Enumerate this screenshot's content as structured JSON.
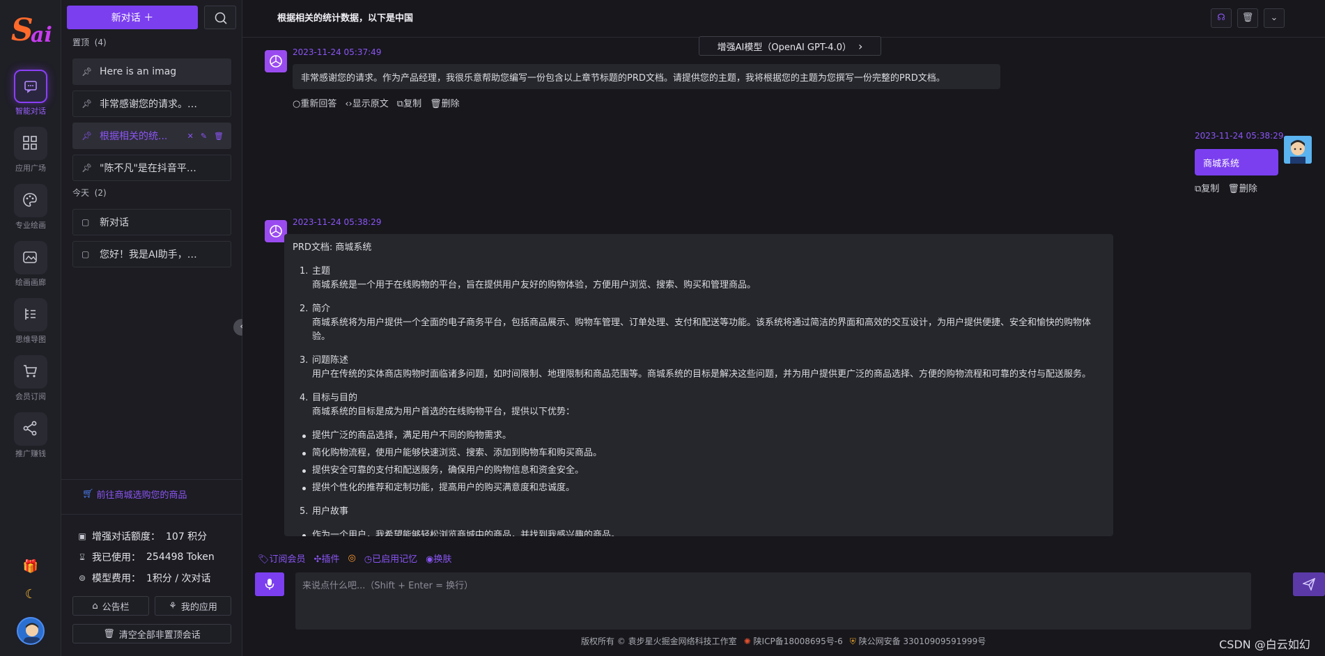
{
  "rail": {
    "items": [
      {
        "label": "智能对话",
        "icon": "chat-icon",
        "active": true
      },
      {
        "label": "应用广场",
        "icon": "grid-icon"
      },
      {
        "label": "专业绘画",
        "icon": "palette-icon"
      },
      {
        "label": "绘画画廊",
        "icon": "gallery-icon"
      },
      {
        "label": "思维导图",
        "icon": "mindmap-icon"
      },
      {
        "label": "会员订阅",
        "icon": "cart-icon"
      },
      {
        "label": "推广赚钱",
        "icon": "share-icon"
      }
    ]
  },
  "sidebar": {
    "new_chat": "新对话 ＋",
    "pinned_label": "置顶",
    "pinned_count": "(4)",
    "today_label": "今天",
    "today_count": "(2)",
    "pinned": [
      "Here is an imag",
      "非常感谢您的请求。作为...",
      "根据相关的统...",
      "\"陈不凡\"是在抖音平台上..."
    ],
    "today": [
      "新对话",
      "您好！我是AI助手，我可..."
    ],
    "shop_link": "前往商城选购您的商品",
    "stats": [
      {
        "label": "增强对话额度：",
        "value": "107 积分"
      },
      {
        "label": "我已使用：",
        "value": "254498 Token"
      },
      {
        "label": "模型费用：",
        "value": "1积分 / 次对话"
      }
    ],
    "notice_btn": "公告栏",
    "my_apps_btn": "我的应用",
    "clear_btn": "清空全部非置顶会话"
  },
  "main": {
    "title": "根据相关的统计数据，以下是中国",
    "model": "增强AI模型（OpenAI GPT-4.0）",
    "msg1": {
      "time": "2023-11-24 05:37:49",
      "text": "非常感谢您的请求。作为产品经理，我很乐意帮助您编写一份包含以上章节标题的PRD文档。请提供您的主题，我将根据您的主题为您撰写一份完整的PRD文档。",
      "actions": [
        "重新回答",
        "显示原文",
        "复制",
        "删除"
      ]
    },
    "msg2": {
      "time": "2023-11-24 05:38:29",
      "text": "商城系统",
      "actions": [
        "复制",
        "删除"
      ]
    },
    "msg3": {
      "time": "2023-11-24 05:38:29",
      "heading": "PRD文档: 商城系统",
      "sections": [
        {
          "num": "1.",
          "title": "主题",
          "body": "商城系统是一个用于在线购物的平台，旨在提供用户友好的购物体验，方便用户浏览、搜索、购买和管理商品。"
        },
        {
          "num": "2.",
          "title": "简介",
          "body": "商城系统将为用户提供一个全面的电子商务平台，包括商品展示、购物车管理、订单处理、支付和配送等功能。该系统将通过简洁的界面和高效的交互设计，为用户提供便捷、安全和愉快的购物体验。"
        },
        {
          "num": "3.",
          "title": "问题陈述",
          "body": "用户在传统的实体商店购物时面临诸多问题，如时间限制、地理限制和商品范围等。商城系统的目标是解决这些问题，并为用户提供更广泛的商品选择、方便的购物流程和可靠的支付与配送服务。"
        },
        {
          "num": "4.",
          "title": "目标与目的",
          "body": "商城系统的目标是成为用户首选的在线购物平台，提供以下优势："
        }
      ],
      "bullets": [
        "提供广泛的商品选择，满足用户不同的购物需求。",
        "简化购物流程，使用户能够快速浏览、搜索、添加到购物车和购买商品。",
        "提供安全可靠的支付和配送服务，确保用户的购物信息和资金安全。",
        "提供个性化的推荐和定制功能，提高用户的购买满意度和忠诚度。"
      ],
      "section5": {
        "num": "5.",
        "title": "用户故事"
      },
      "cut_line": "作为一个用户，我希望能够轻松浏览商城中的商品，并找到我感兴趣的商品。"
    },
    "tools": [
      "订阅会员",
      "插件",
      "已启用记忆",
      "换肤"
    ],
    "input_placeholder": "来说点什么吧...（Shift + Enter = 换行）",
    "footer": {
      "copyright": "版权所有 © 袁步星火掘金网络科技工作室",
      "icp": "陕ICP备18008695号-6",
      "police": "陕公网安备 33010909591999号"
    },
    "watermark": "CSDN @白云如幻"
  },
  "colors": {
    "accent": "#7b3ff0",
    "accent_text": "#8b55f5",
    "bg": "#17171c",
    "panel": "#1c1c22",
    "bubble": "#26262d"
  }
}
